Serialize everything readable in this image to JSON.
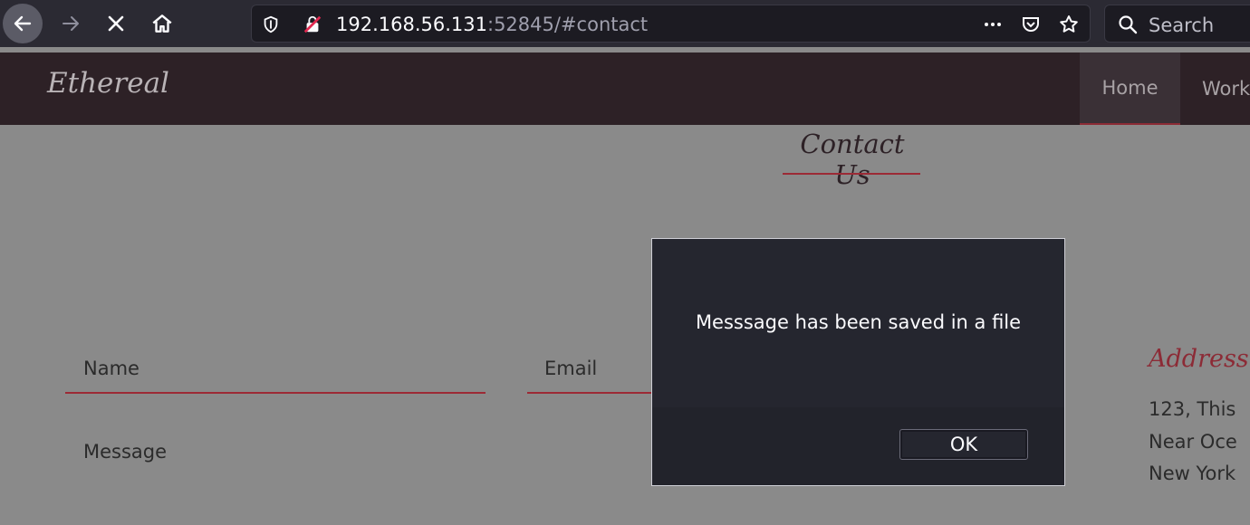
{
  "browser": {
    "url_host": "192.168.56.131",
    "url_rest": ":52845/#contact",
    "search_placeholder": "Search",
    "icons": [
      "back-arrow-icon",
      "forward-arrow-icon",
      "stop-icon",
      "home-icon",
      "shield-icon",
      "insecure-lock-icon",
      "more-icon",
      "pocket-icon",
      "star-icon",
      "search-icon"
    ]
  },
  "site": {
    "brand": "Ethereal",
    "nav": [
      {
        "label": "Home",
        "active": true
      },
      {
        "label": "Work",
        "active": false
      }
    ]
  },
  "contact": {
    "title": "Contact Us",
    "name_label": "Name",
    "email_label": "Email",
    "message_label": "Message",
    "address_title": "Address",
    "address_lines": [
      "123, This",
      "Near Oce",
      "New York"
    ]
  },
  "dialog": {
    "message": "Messsage has been saved in a file",
    "ok_label": "OK"
  },
  "colors": {
    "accent": "#9c2a35",
    "header_bg": "#2d2126",
    "overlay_bg": "#8a8a8a",
    "dialog_bg": "#25262f"
  }
}
